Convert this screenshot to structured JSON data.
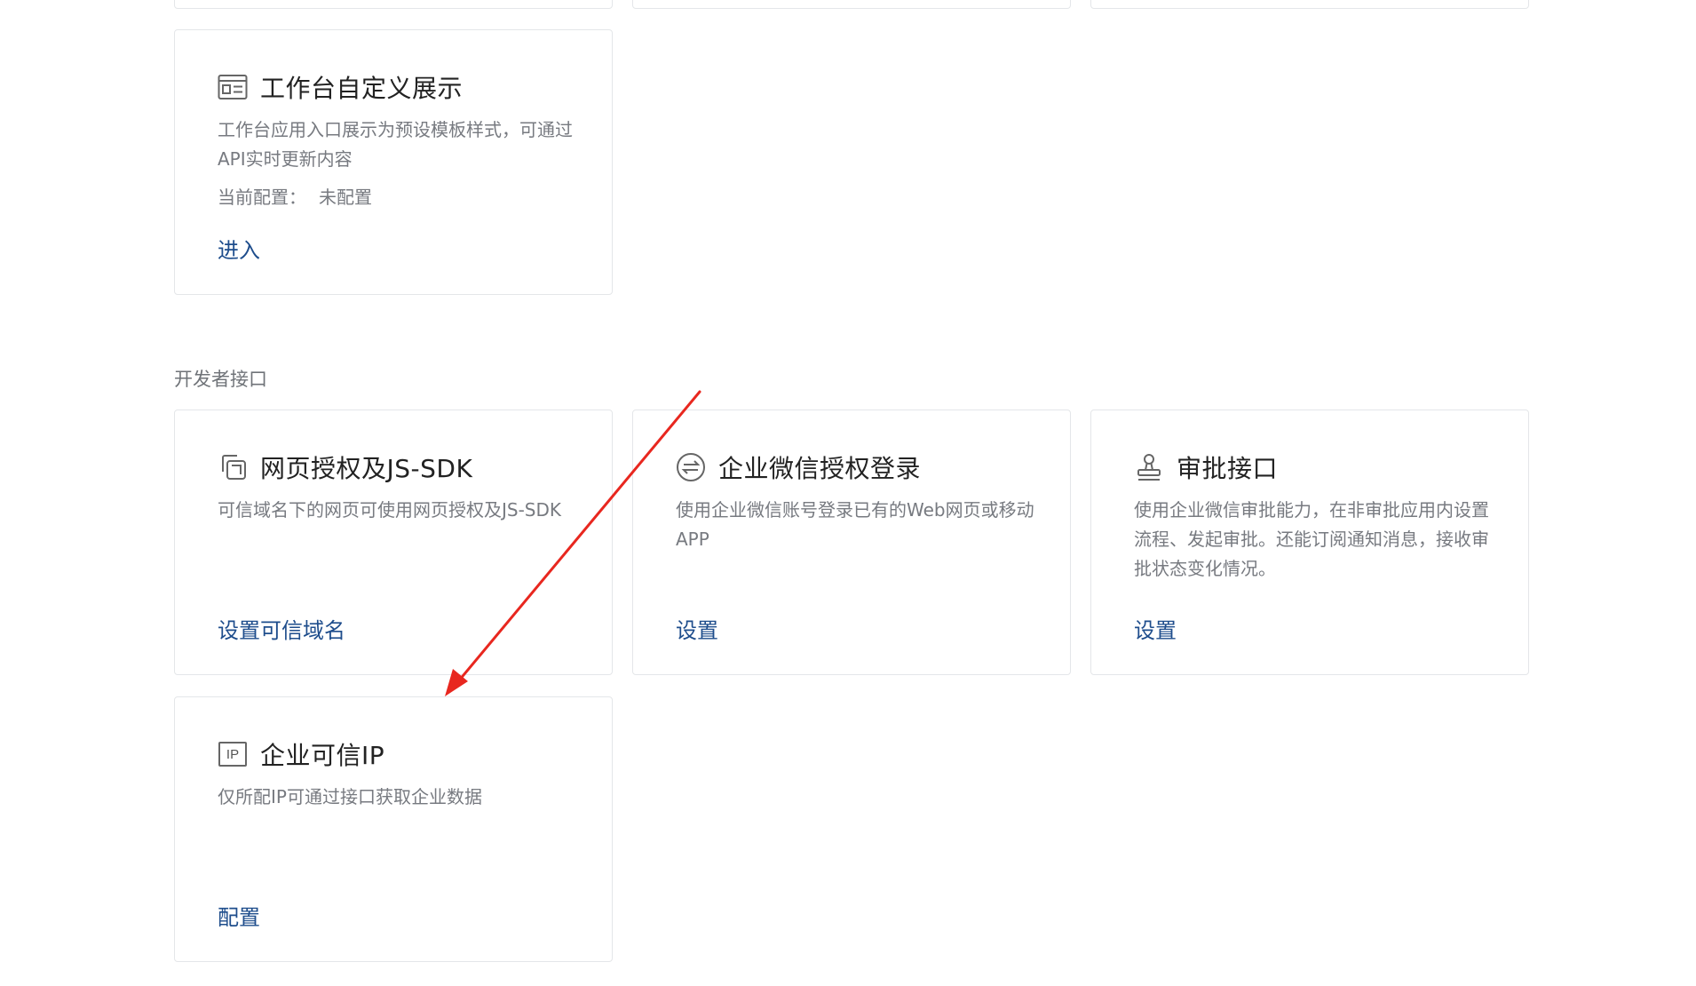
{
  "workbench_card": {
    "title": "工作台自定义展示",
    "description": "工作台应用入口展示为预设模板样式，可通过API实时更新内容",
    "config_label": "当前配置：",
    "config_value": "未配置",
    "link": "进入",
    "icon": "card-display-icon"
  },
  "developer_section": {
    "title": "开发者接口",
    "cards": [
      {
        "title": "网页授权及JS-SDK",
        "description": "可信域名下的网页可使用网页授权及JS-SDK",
        "link": "设置可信域名",
        "icon": "copy-pages-icon"
      },
      {
        "title": "企业微信授权登录",
        "description": "使用企业微信账号登录已有的Web网页或移动APP",
        "link": "设置",
        "icon": "exchange-circle-icon"
      },
      {
        "title": "审批接口",
        "description": "使用企业微信审批能力，在非审批应用内设置流程、发起审批。还能订阅通知消息，接收审批状态变化情况。",
        "link": "设置",
        "icon": "stamp-icon"
      },
      {
        "title": "企业可信IP",
        "description": "仅所配IP可通过接口获取企业数据",
        "link": "配置",
        "icon": "ip-icon",
        "icon_text": "IP"
      }
    ]
  },
  "colors": {
    "link": "#1e4d8c",
    "border": "#e4e6e9",
    "muted_text": "#777a80",
    "annotation_arrow": "#e8271f"
  }
}
